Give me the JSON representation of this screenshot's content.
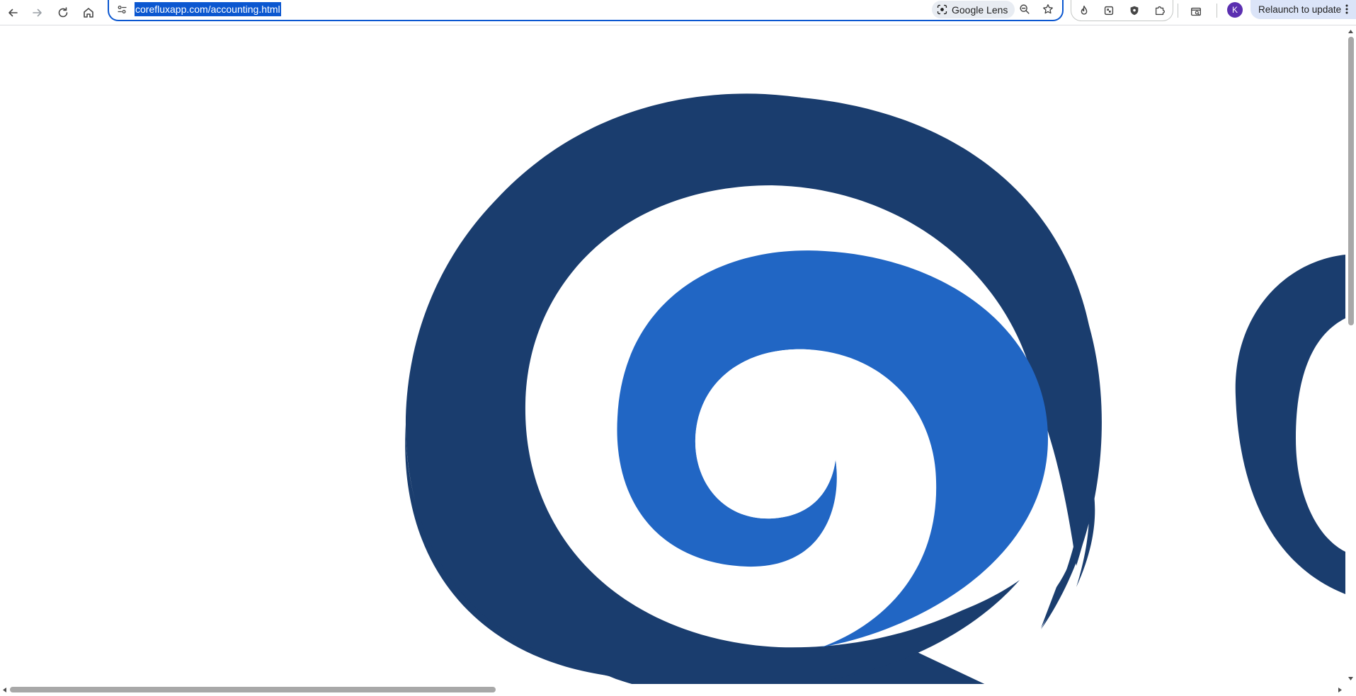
{
  "toolbar": {
    "icons": [
      "back-icon",
      "forward-icon",
      "reload-icon",
      "home-icon"
    ],
    "address_bar": {
      "url": "corefluxapp.com/accounting.html",
      "site_info_icon": "tune-icon",
      "lens_label": "Google Lens",
      "zoom_icon": "zoom-out-icon",
      "bookmark_icon": "star-icon"
    },
    "extensions": [
      "flame-extension-icon",
      "doc-extension-icon",
      "shield-extension-icon",
      "puzzle-extensions-icon"
    ],
    "tab_search_icon": "tab-search-icon",
    "profile_initial": "K",
    "relaunch_label": "Relaunch to update"
  },
  "content": {
    "logo_icon": "spiral-logo",
    "colors": {
      "outer": "#1a3d6e",
      "inner": "#2166c4",
      "background": "#ffffff"
    }
  },
  "theme": {
    "accent": "#0b57d0",
    "relaunch_bg": "#dbe4f8",
    "avatar": "#5b2fb0"
  }
}
